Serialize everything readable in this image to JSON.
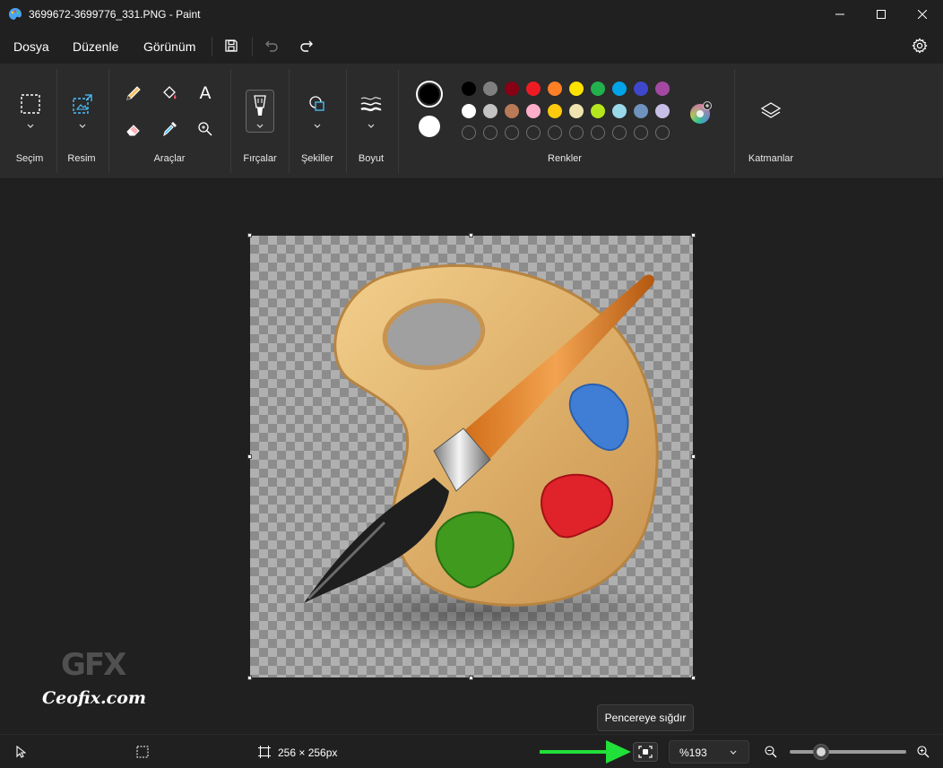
{
  "window": {
    "title": "3699672-3699776_331.PNG - Paint"
  },
  "menu": {
    "items": [
      "Dosya",
      "Düzenle",
      "Görünüm"
    ]
  },
  "ribbon": {
    "groups": {
      "selection": "Seçim",
      "image": "Resim",
      "tools": "Araçlar",
      "brushes": "Fırçalar",
      "shapes": "Şekiller",
      "size": "Boyut",
      "colors": "Renkler",
      "layers": "Katmanlar"
    },
    "text_tool_glyph": "A",
    "primary_color": "#000000",
    "secondary_color": "#ffffff",
    "palette_row1": [
      "#000000",
      "#7f7f7f",
      "#880015",
      "#ed1c24",
      "#ff7f27",
      "#ffe200",
      "#22b14c",
      "#00a2e8",
      "#3f48cc",
      "#a349a4"
    ],
    "palette_row2": [
      "#ffffff",
      "#c3c3c3",
      "#b97a57",
      "#ffaec9",
      "#ffc90e",
      "#efe4b0",
      "#b5e61d",
      "#99d9ea",
      "#7092be",
      "#c8bfe7"
    ]
  },
  "watermark": {
    "logo": "GFX",
    "text": "Ceofix.com"
  },
  "tooltip": {
    "text": "Pencereye sığdır"
  },
  "status": {
    "image_size": "256 × 256px",
    "zoom": "%193",
    "zoom_fraction": 0.27
  },
  "colors": {
    "accent": "#4cc2ff",
    "arrow": "#22e03a"
  }
}
